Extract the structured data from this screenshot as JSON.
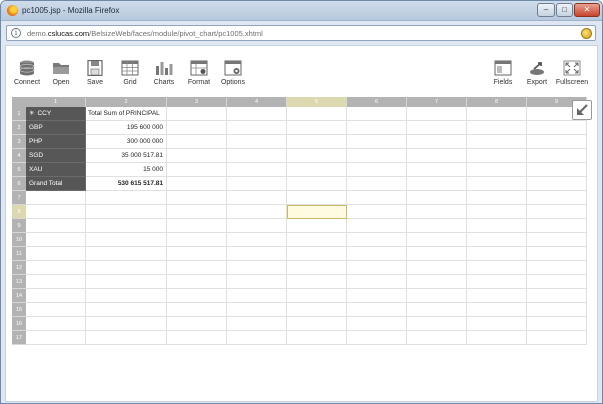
{
  "window": {
    "title": "pc1005.jsp - Mozilla Firefox",
    "min_glyph": "–",
    "max_glyph": "□",
    "close_glyph": "✕"
  },
  "address": {
    "url_prefix": "demo.",
    "url_domain": "cslucas.com",
    "url_path": "/BelsizeWeb/faces/module/pivot_chart/pc1005.xhtml",
    "info_glyph": "i"
  },
  "toolbar": {
    "connect": "Connect",
    "open": "Open",
    "save": "Save",
    "grid": "Grid",
    "charts": "Charts",
    "format": "Format",
    "options": "Options",
    "fields": "Fields",
    "export": "Export",
    "fullscreen": "Fullscreen"
  },
  "grid": {
    "columns": [
      "1",
      "2",
      "3",
      "4",
      "5",
      "6",
      "7",
      "8",
      "9"
    ],
    "rows": [
      "1",
      "2",
      "3",
      "4",
      "5",
      "6",
      "7",
      "8",
      "9",
      "10",
      "11",
      "12",
      "13",
      "14",
      "15",
      "16",
      "17"
    ],
    "selected_column": "5",
    "selected_row": "8",
    "pivot_header": "CCY",
    "pivot_header_glyph": "✳",
    "value_header": "Total Sum of PRINCIPAL",
    "data_rows": [
      {
        "label": "GBP",
        "value": "195 600 000"
      },
      {
        "label": "PHP",
        "value": "300 000 000"
      },
      {
        "label": "SGD",
        "value": "35 000 517.81"
      },
      {
        "label": "XAU",
        "value": "15 000"
      }
    ],
    "total": {
      "label": "Grand Total",
      "value": "530 615 517.81"
    }
  },
  "colors": {
    "dark_cell": "#575757",
    "header_gray": "#b3b3b3",
    "selection": "#fffbe0"
  }
}
